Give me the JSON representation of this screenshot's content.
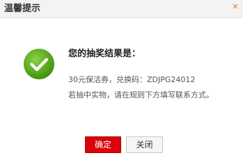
{
  "dialog": {
    "title": "温馨提示",
    "close_glyph": "×"
  },
  "result": {
    "heading": "您的抽奖结果是：",
    "prize": "30元保洁券，兑换码：ZDJPG24012",
    "note": "若抽中实物，请在规则下方填写联系方式。",
    "icon": "check-circle-icon"
  },
  "buttons": {
    "confirm_label": "确定",
    "close_label": "关闭"
  },
  "colors": {
    "success_green": "#5aaa1e",
    "confirm_red": "#d9040b",
    "close_x": "#dd7a2a"
  }
}
